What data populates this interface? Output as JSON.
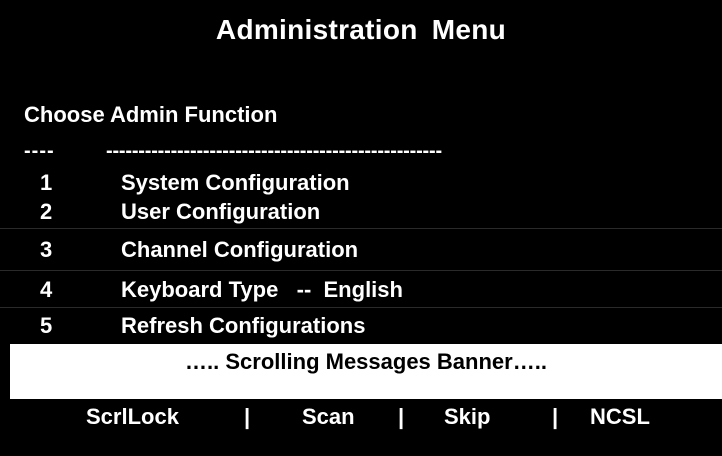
{
  "header": {
    "title": "Administration  Menu"
  },
  "prompt": {
    "text": "Choose Admin Function"
  },
  "separator": {
    "left": "----",
    "right": "----------------------------------------------------"
  },
  "menu": {
    "items": [
      {
        "number": "1",
        "label": "System Configuration"
      },
      {
        "number": "2",
        "label": "User Configuration"
      },
      {
        "number": "3",
        "label": "Channel Configuration"
      },
      {
        "number": "4",
        "label": "Keyboard Type   --  English"
      },
      {
        "number": "5",
        "label": "Refresh Configurations"
      }
    ]
  },
  "banner": {
    "text": "….. Scrolling Messages Banner….."
  },
  "footer": {
    "scrllock": "ScrlLock",
    "scan": "Scan",
    "skip": "Skip",
    "ncsl": "NCSL",
    "separator": "|"
  },
  "colors": {
    "background": "#000000",
    "foreground": "#ffffff",
    "banner_background": "#ffffff",
    "banner_text": "#000000"
  }
}
